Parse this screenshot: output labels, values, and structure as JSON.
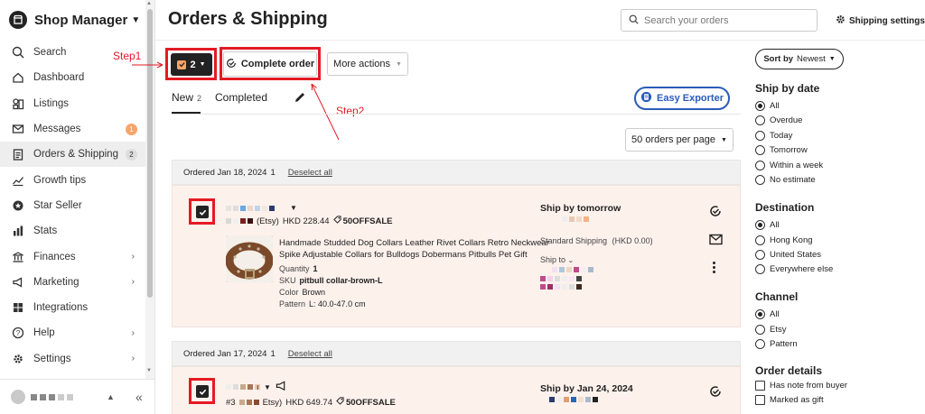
{
  "sidebar": {
    "title": "Shop Manager",
    "items": [
      {
        "label": "Search",
        "icon": "search-icon"
      },
      {
        "label": "Dashboard",
        "icon": "dashboard-icon"
      },
      {
        "label": "Listings",
        "icon": "listings-icon"
      },
      {
        "label": "Messages",
        "icon": "messages-icon",
        "badge": "1"
      },
      {
        "label": "Orders & Shipping",
        "icon": "orders-icon",
        "badge": "2"
      },
      {
        "label": "Growth tips",
        "icon": "growth-icon"
      },
      {
        "label": "Star Seller",
        "icon": "star-seller-icon"
      },
      {
        "label": "Stats",
        "icon": "stats-icon"
      },
      {
        "label": "Finances",
        "icon": "finances-icon"
      },
      {
        "label": "Marketing",
        "icon": "marketing-icon"
      },
      {
        "label": "Integrations",
        "icon": "integrations-icon"
      },
      {
        "label": "Help",
        "icon": "help-icon"
      },
      {
        "label": "Settings",
        "icon": "settings-icon"
      }
    ]
  },
  "header": {
    "title": "Orders & Shipping",
    "search_placeholder": "Search your orders",
    "shipping_settings": "Shipping settings"
  },
  "toolbar": {
    "selected_count": "2",
    "complete_order": "Complete order",
    "more_actions": "More actions"
  },
  "annotations": {
    "step1": "Step1",
    "step2": "Step2"
  },
  "tabs": {
    "new_label": "New",
    "new_count": "2",
    "completed_label": "Completed",
    "easy_exporter": "Easy Exporter",
    "per_page": "50 orders per page"
  },
  "groups": [
    {
      "ordered": "Ordered Jan 18, 2024",
      "count": "1",
      "deselect": "Deselect all",
      "platform": "(Etsy)",
      "price": "HKD 228.44",
      "coupon": "50OFFSALE",
      "product_title": "Handmade Studded Dog Collars Leather Rivet Collars Retro Neckwear Spike Adjustable Collars for Bulldogs Dobermans Pitbulls Pet Gift",
      "quantity_label": "Quantity",
      "quantity": "1",
      "sku_label": "SKU",
      "sku": "pitbull collar-brown-L",
      "color_label": "Color",
      "color": "Brown",
      "pattern_label": "Pattern",
      "pattern": "L: 40.0-47.0 cm",
      "ship_by": "Ship by tomorrow",
      "shipping_method": "Standard Shipping",
      "shipping_cost": "(HKD 0.00)",
      "ship_to": "Ship to"
    },
    {
      "ordered": "Ordered Jan 17, 2024",
      "count": "1",
      "deselect": "Deselect all",
      "order_prefix": "#3",
      "platform": "Etsy)",
      "price": "HKD 649.74",
      "coupon": "50OFFSALE",
      "ship_by": "Ship by Jan 24, 2024"
    }
  ],
  "filters": {
    "sort_label": "Sort by",
    "sort_value": "Newest",
    "ship_by_date": {
      "title": "Ship by date",
      "options": [
        "All",
        "Overdue",
        "Today",
        "Tomorrow",
        "Within a week",
        "No estimate"
      ],
      "selected": "All"
    },
    "destination": {
      "title": "Destination",
      "options": [
        "All",
        "Hong Kong",
        "United States",
        "Everywhere else"
      ],
      "selected": "All"
    },
    "channel": {
      "title": "Channel",
      "options": [
        "All",
        "Etsy",
        "Pattern"
      ],
      "selected": "All"
    },
    "order_details": {
      "title": "Order details",
      "options": [
        "Has note from buyer",
        "Marked as gift"
      ]
    }
  },
  "colors": {
    "accent_orange": "#f7a46b",
    "annotation_red": "#e31b23",
    "exporter_blue": "#2b5ab9",
    "card_bg": "#fdf1ec"
  }
}
